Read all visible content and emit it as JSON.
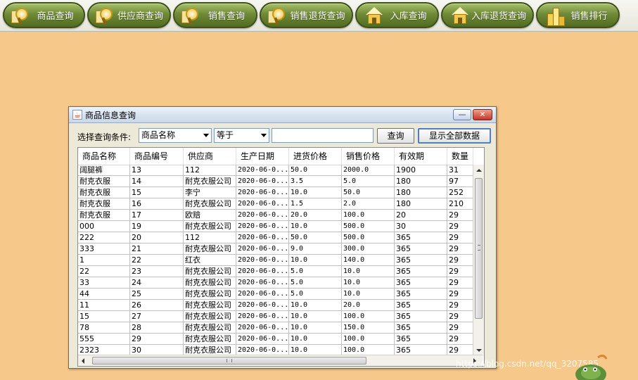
{
  "toolbar": {
    "buttons": [
      {
        "label": "商品查询",
        "icon": "magnifier-icon"
      },
      {
        "label": "供应商查询",
        "icon": "supplier-search-icon"
      },
      {
        "label": "销售查询",
        "icon": "sales-search-icon"
      },
      {
        "label": "销售退货查询",
        "icon": "sales-return-search-icon"
      },
      {
        "label": "入库查询",
        "icon": "warehouse-icon"
      },
      {
        "label": "入库退货查询",
        "icon": "warehouse-return-icon"
      },
      {
        "label": "销售排行",
        "icon": "bar-chart-icon"
      }
    ]
  },
  "window": {
    "title": "商品信息查询",
    "minimize_glyph": "—",
    "close_glyph": "✕"
  },
  "query": {
    "condition_label": "选择查询条件:",
    "field_selected": "商品名称",
    "operator_selected": "等于",
    "search_value": "",
    "search_button": "查询",
    "show_all_button": "显示全部数据"
  },
  "table": {
    "columns": [
      "商品名称",
      "商品编号",
      "供应商",
      "生产日期",
      "进货价格",
      "销售价格",
      "有效期",
      "数量"
    ],
    "rows": [
      [
        "阔腿裤",
        "13",
        "112",
        "2020-06-0...",
        "50.0",
        "2000.0",
        "1900",
        "31"
      ],
      [
        "耐克衣服",
        "14",
        "耐克衣服公司",
        "2020-06-0...",
        "3.5",
        "5.0",
        "180",
        "97"
      ],
      [
        "耐克衣服",
        "15",
        "李宁",
        "2020-06-0...",
        "10.0",
        "50.0",
        "180",
        "252"
      ],
      [
        "耐克衣服",
        "16",
        "耐克衣服公司",
        "2020-06-0...",
        "1.5",
        "2.0",
        "180",
        "210"
      ],
      [
        "耐克衣服",
        "17",
        "欧赔",
        "2020-06-0...",
        "20.0",
        "100.0",
        "20",
        "29"
      ],
      [
        "000",
        "19",
        "耐克衣服公司",
        "2020-06-0...",
        "10.0",
        "500.0",
        "30",
        "29"
      ],
      [
        "222",
        "20",
        "112",
        "2020-06-0...",
        "50.0",
        "500.0",
        "365",
        "29"
      ],
      [
        "333",
        "21",
        "耐克衣服公司",
        "2020-06-0...",
        "9.0",
        "300.0",
        "365",
        "29"
      ],
      [
        "1",
        "22",
        "红衣",
        "2020-06-0...",
        "10.0",
        "140.0",
        "365",
        "29"
      ],
      [
        "22",
        "23",
        "耐克衣服公司",
        "2020-06-0...",
        "5.0",
        "10.0",
        "365",
        "29"
      ],
      [
        "33",
        "24",
        "耐克衣服公司",
        "2020-06-0...",
        "5.0",
        "10.0",
        "365",
        "29"
      ],
      [
        "44",
        "25",
        "耐克衣服公司",
        "2020-06-0...",
        "5.0",
        "10.0",
        "365",
        "29"
      ],
      [
        "11",
        "26",
        "耐克衣服公司",
        "2020-06-0...",
        "10.0",
        "20.0",
        "365",
        "29"
      ],
      [
        "15",
        "27",
        "耐克衣服公司",
        "2020-06-0...",
        "10.0",
        "100.0",
        "365",
        "29"
      ],
      [
        "78",
        "28",
        "耐克衣服公司",
        "2020-06-0...",
        "10.0",
        "150.0",
        "365",
        "29"
      ],
      [
        "555",
        "29",
        "耐克衣服公司",
        "2020-06-0...",
        "10.0",
        "100.0",
        "365",
        "29"
      ],
      [
        "2323",
        "30",
        "耐克衣服公司",
        "2020-06-0...",
        "10.0",
        "100.0",
        "365",
        "29"
      ]
    ]
  },
  "watermark": "https://blog.csdn.net/qq_3207585",
  "colors": {
    "background": "#f6c88a",
    "nav_button": "#6f8a36",
    "window_frame": "#ece9d8",
    "close_button": "#c4352a"
  }
}
